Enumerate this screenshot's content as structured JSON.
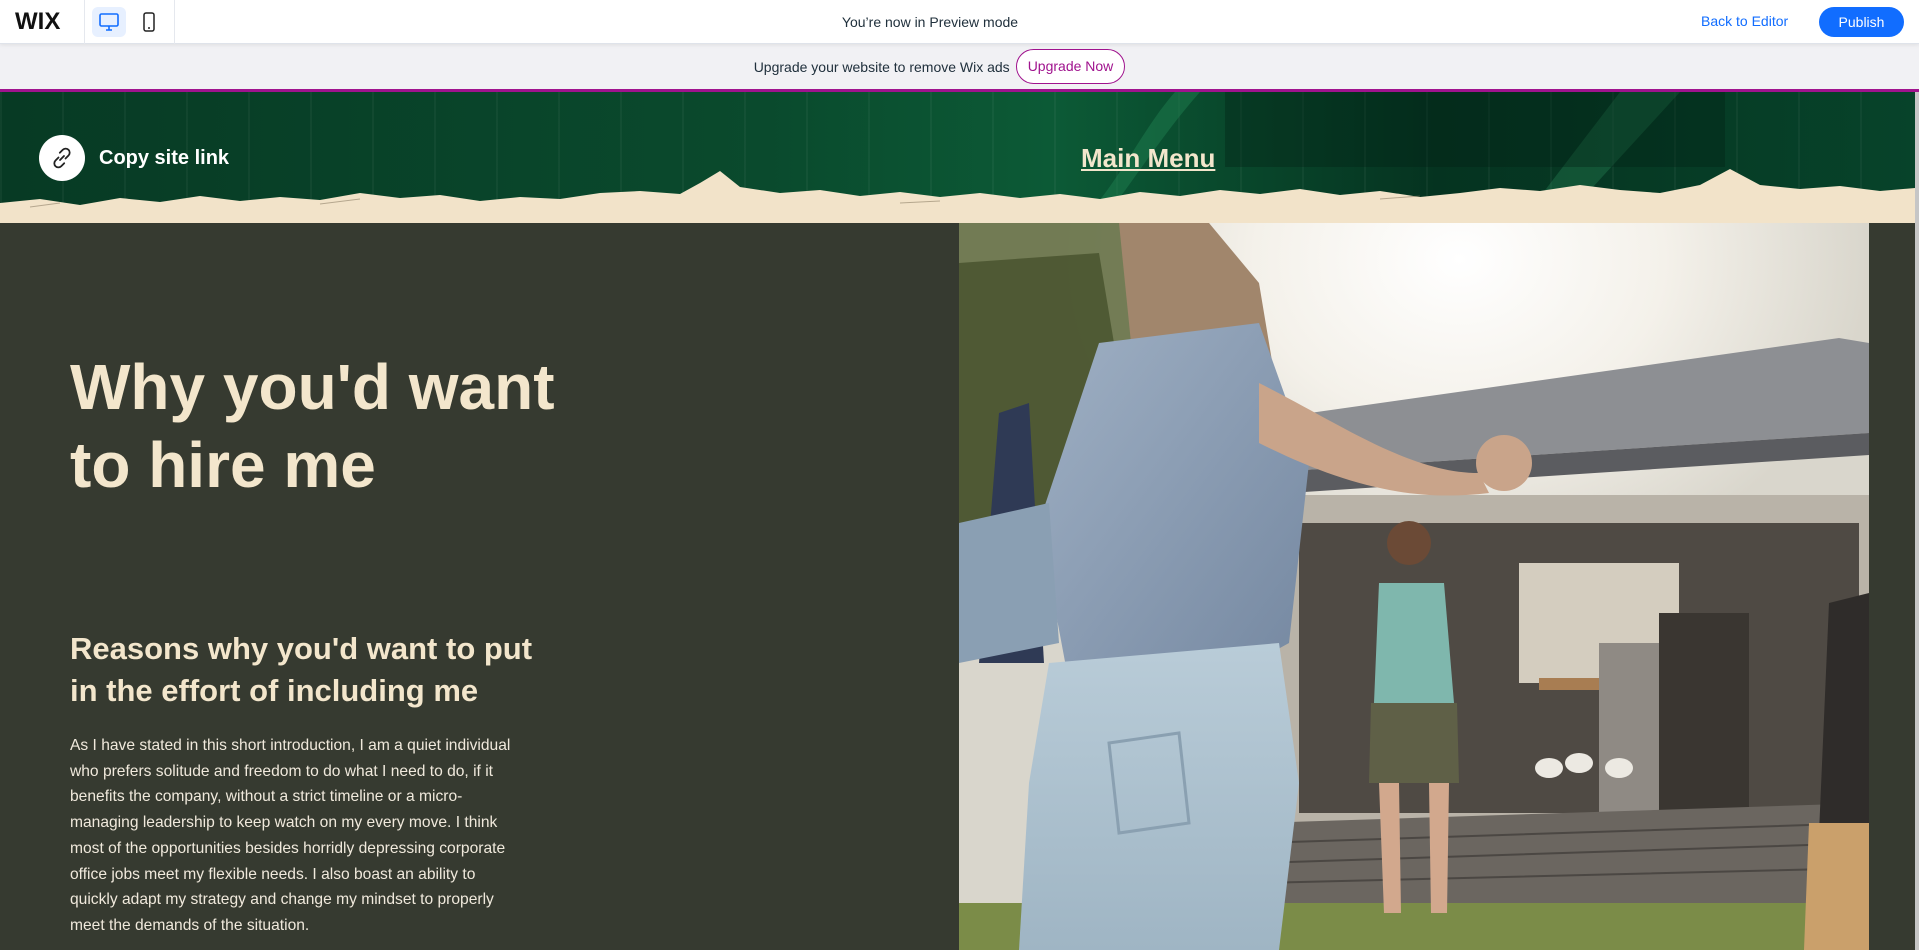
{
  "topbar": {
    "logo": "WIX",
    "desktop_icon": "desktop-icon",
    "mobile_icon": "mobile-icon",
    "preview_message": "You’re now in Preview mode",
    "back_to_editor": "Back to Editor",
    "publish": "Publish"
  },
  "banner": {
    "text": "Upgrade your website to remove Wix ads",
    "button": "Upgrade Now"
  },
  "site_header": {
    "copy_link_icon": "link-icon",
    "copy_link_label": "Copy site link",
    "main_menu": "Main Menu"
  },
  "section": {
    "headline": "Why you'd want to hire me",
    "subheading": "Reasons why you'd want to put in the effort of including me",
    "body": "As I have stated in this short introduction, I am a quiet individual who prefers solitude and freedom to do what I need to do, if it benefits the company, without a strict timeline or a micro-managing leadership to keep watch on my every move. I think most of the opportunities besides horridly depressing corporate office jobs meet my flexible needs. I also boast an ability to quickly adapt my strategy and change my mindset to properly meet the demands of the situation."
  },
  "colors": {
    "wix_blue": "#116dff",
    "upgrade_purple": "#a0138e",
    "header_green": "#0a4a2d",
    "cream": "#f3e6cc",
    "section_bg": "#363a30"
  }
}
